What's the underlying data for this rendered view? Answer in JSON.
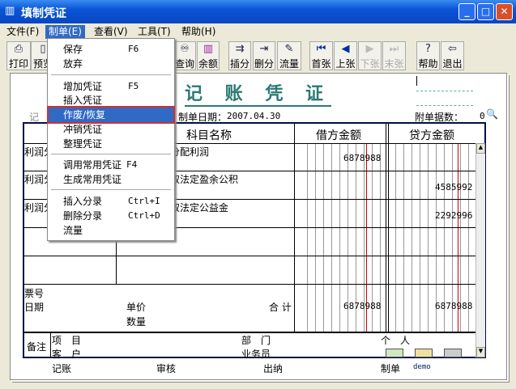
{
  "window": {
    "title": "填制凭证"
  },
  "menubar": [
    "文件(F)",
    "制单(E)",
    "查看(V)",
    "工具(T)",
    "帮助(H)"
  ],
  "toolbar": [
    {
      "label": "打印",
      "icon": "printer-icon",
      "enabled": true
    },
    {
      "label": "预览",
      "icon": "preview-icon",
      "enabled": true
    },
    {
      "label": "查询",
      "icon": "binoculars-icon",
      "enabled": true
    },
    {
      "label": "余额",
      "icon": "bar-chart-icon",
      "enabled": true
    },
    {
      "label": "插分",
      "icon": "insert-entry-icon",
      "enabled": true
    },
    {
      "label": "删分",
      "icon": "delete-entry-icon",
      "enabled": true
    },
    {
      "label": "流量",
      "icon": "flow-icon",
      "enabled": true
    },
    {
      "label": "首张",
      "icon": "first-icon",
      "enabled": true
    },
    {
      "label": "上张",
      "icon": "prev-icon",
      "enabled": true
    },
    {
      "label": "下张",
      "icon": "next-icon",
      "enabled": false
    },
    {
      "label": "末张",
      "icon": "last-icon",
      "enabled": false
    },
    {
      "label": "帮助",
      "icon": "help-icon",
      "enabled": true
    },
    {
      "label": "退出",
      "icon": "exit-icon",
      "enabled": true
    }
  ],
  "menu": [
    {
      "label": "保存",
      "key": "F6"
    },
    {
      "label": "放弃",
      "key": ""
    },
    {
      "label": "增加凭证",
      "key": "F5"
    },
    {
      "label": "插入凭证",
      "key": ""
    },
    {
      "label": "作废/恢复",
      "key": "",
      "selected": true
    },
    {
      "label": "冲销凭证",
      "key": ""
    },
    {
      "label": "整理凭证",
      "key": ""
    },
    {
      "label": "调用常用凭证",
      "key": "F4"
    },
    {
      "label": "生成常用凭证",
      "key": ""
    },
    {
      "label": "插入分录",
      "key": "Ctrl+I"
    },
    {
      "label": "删除分录",
      "key": "Ctrl+D"
    },
    {
      "label": "流量",
      "key": ""
    }
  ],
  "voucher": {
    "title": "记 账 凭 证",
    "type_label": "记",
    "date_label": "制单日期：",
    "date": "2007.04.30",
    "attach_label": "附单据数：",
    "attach_count": "0",
    "headers": {
      "subject": "科目名称",
      "debit": "借方金额",
      "credit": "贷方金额"
    },
    "rows": [
      {
        "summary": "利润分",
        "subject": "分配利润",
        "debit": "6878988",
        "credit": ""
      },
      {
        "summary": "利润分",
        "subject": "取法定盈余公积",
        "debit": "",
        "credit": "4585992"
      },
      {
        "summary": "利润分",
        "subject": "取法定公益金",
        "debit": "",
        "credit": "2292996"
      }
    ],
    "footer": {
      "ticket": "票号",
      "date": "日期",
      "price": "单价",
      "qty": "数量",
      "total_label": "合 计",
      "total_debit": "6878988",
      "total_credit": "6878988"
    },
    "notes": {
      "label": "备注",
      "project": "项　目",
      "customer": "客　户",
      "dept": "部　门",
      "salesman": "业务员",
      "person": "个　人"
    },
    "signatures": {
      "posting": "记账",
      "audit": "审核",
      "cashier": "出纳",
      "maker_label": "制单",
      "maker": "demo"
    }
  }
}
